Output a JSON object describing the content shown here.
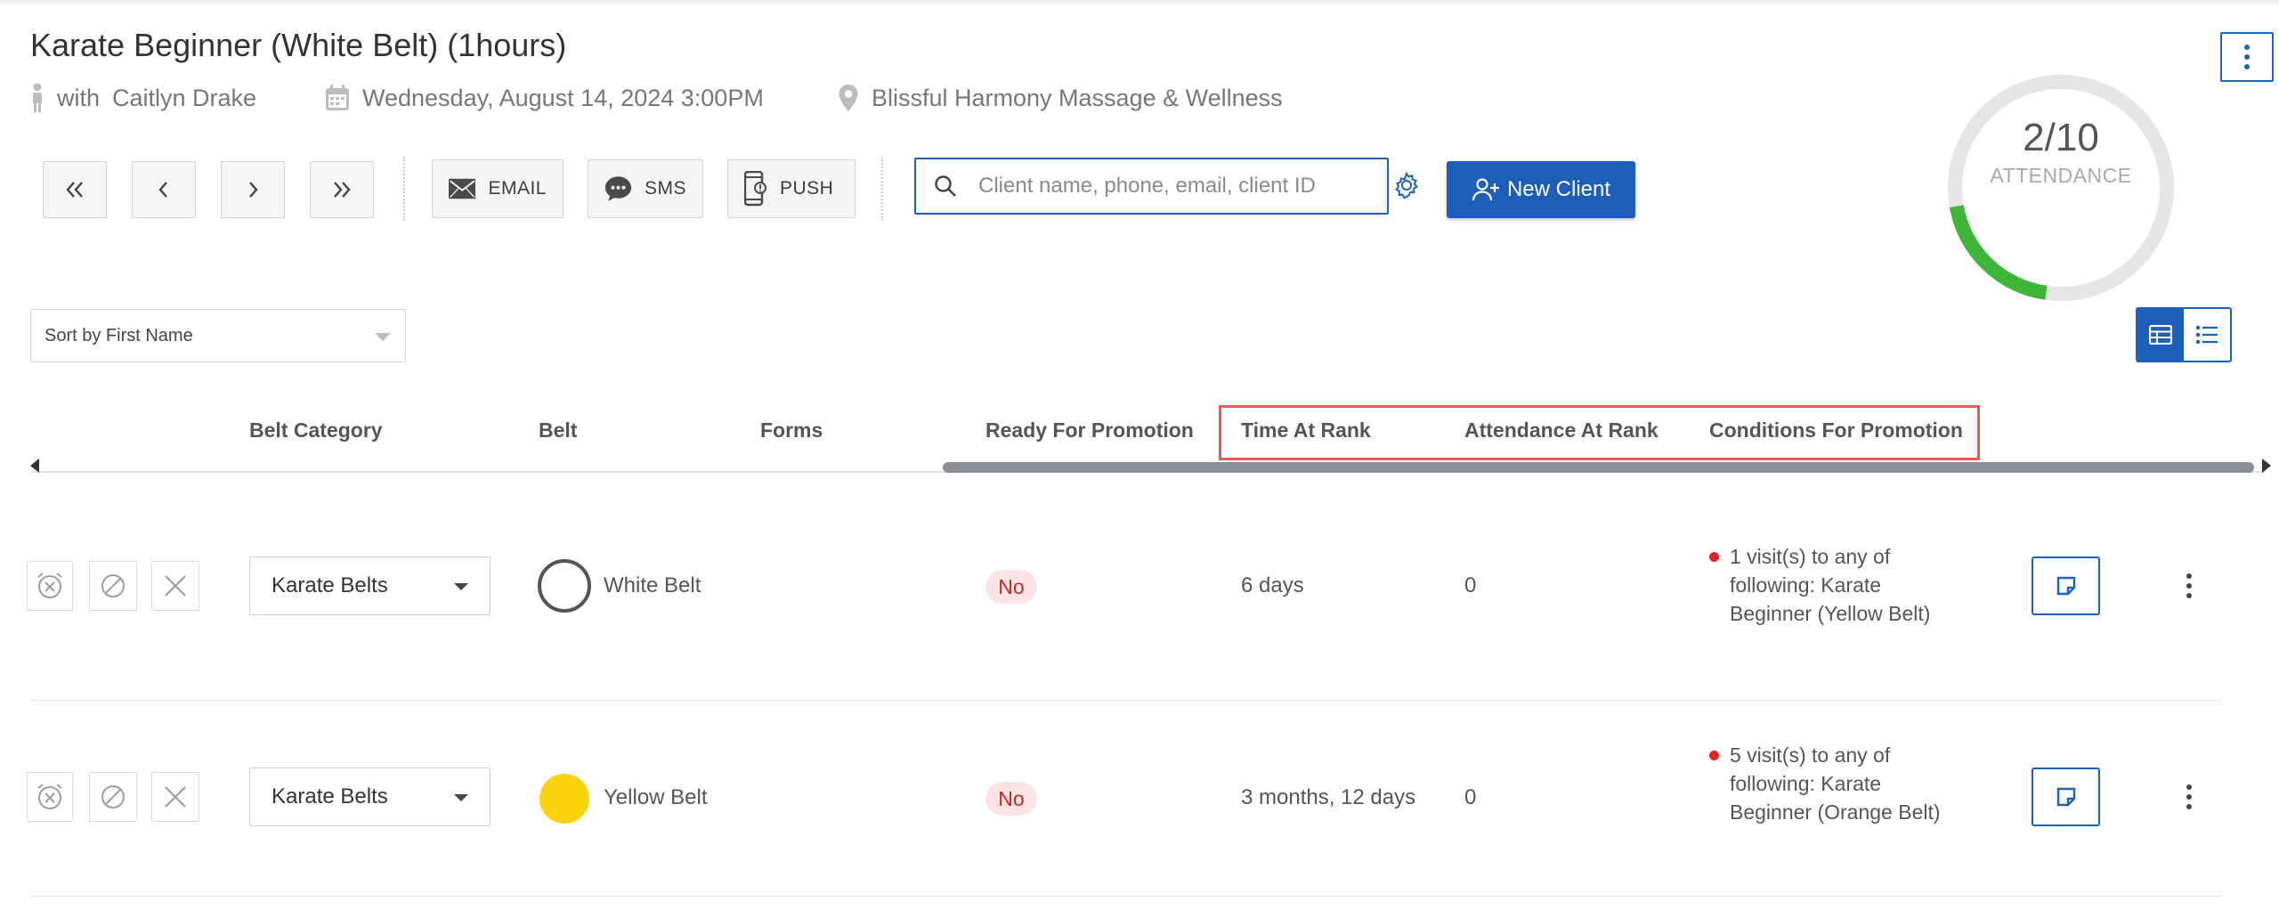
{
  "header": {
    "title": "Karate Beginner (White Belt)",
    "duration": "(1hours)",
    "with_label": "with",
    "instructor": "Caitlyn Drake",
    "datetime": "Wednesday, August 14, 2024 3:00PM",
    "location": "Blissful Harmony Massage & Wellness"
  },
  "toolbar": {
    "email_label": "EMAIL",
    "sms_label": "SMS",
    "push_label": "PUSH",
    "search_placeholder": "Client name, phone, email, client ID",
    "new_client_label": "New Client"
  },
  "attendance": {
    "value": "2/10",
    "label": "ATTENDANCE",
    "attended": 2,
    "capacity": 10,
    "ring_color": "#3fb63a"
  },
  "sort": {
    "selected": "Sort by First Name"
  },
  "table": {
    "headers": {
      "belt_category": "Belt Category",
      "belt": "Belt",
      "forms": "Forms",
      "ready": "Ready For Promotion",
      "time_at_rank": "Time At Rank",
      "attendance_at_rank": "Attendance At Rank",
      "conditions": "Conditions For Promotion"
    },
    "rows": [
      {
        "belt_category": "Karate Belts",
        "belt": "White Belt",
        "belt_color": "#ffffff",
        "ready": "No",
        "time_at_rank": "6 days",
        "attendance_at_rank": "0",
        "conditions": "1 visit(s) to any of following: Karate Beginner (Yellow Belt)"
      },
      {
        "belt_category": "Karate Belts",
        "belt": "Yellow Belt",
        "belt_color": "#fdd20e",
        "ready": "No",
        "time_at_rank": "3 months, 12 days",
        "attendance_at_rank": "0",
        "conditions": "5 visit(s) to any of following: Karate Beginner (Orange Belt)"
      }
    ]
  },
  "colors": {
    "primary": "#1d5fb8",
    "highlight_border": "#e85a5a",
    "danger": "#c62828"
  }
}
